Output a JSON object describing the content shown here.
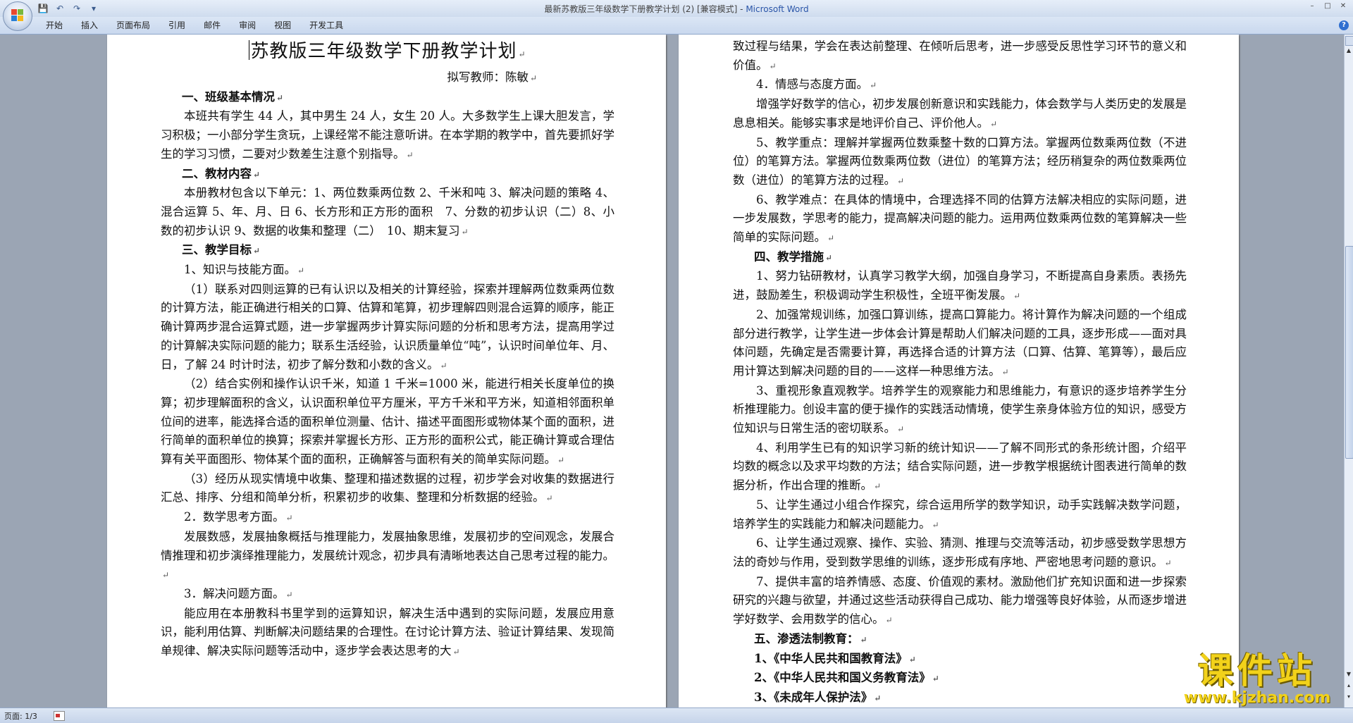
{
  "window": {
    "title": "最新苏教版三年级数学下册教学计划 (2) [兼容模式] - ",
    "app_name": "Microsoft Word"
  },
  "ribbon": {
    "tabs": [
      "开始",
      "插入",
      "页面布局",
      "引用",
      "邮件",
      "审阅",
      "视图",
      "开发工具"
    ]
  },
  "quick_access": [
    "save-icon",
    "undo-icon",
    "redo-icon",
    "customize-icon"
  ],
  "status": {
    "page": "页面: 1/3"
  },
  "watermark": {
    "text": "课件站",
    "url": "www.kjzhan.com"
  },
  "page_left": {
    "title": "苏教版三年级数学下册教学计划",
    "author": "拟写教师：陈敏",
    "paragraphs": [
      {
        "cls": "h",
        "text": "一、班级基本情况"
      },
      {
        "cls": "ind2",
        "text": "本班共有学生 44 人，其中男生 24 人，女生 20 人。大多数学生上课大胆发言，学习积极；一小部分学生贪玩，上课经常不能注意听讲。在本学期的教学中，首先要抓好学生的学习习惯，二要对少数差生注意个别指导。"
      },
      {
        "cls": "h",
        "text": "二、教材内容"
      },
      {
        "cls": "ind2",
        "text": "本册教材包含以下单元：1、两位数乘两位数 2、千米和吨 3、解决问题的策略 4、混合运算 5、年、月、日 6、长方形和正方形的面积　7、分数的初步认识（二）8、小数的初步认识 9、数据的收集和整理（二）　10、期末复习"
      },
      {
        "cls": "h",
        "text": "三、教学目标"
      },
      {
        "cls": "ind2",
        "text": "1、知识与技能方面。"
      },
      {
        "cls": "ind2",
        "text": "（1）联系对四则运算的已有认识以及相关的计算经验，探索并理解两位数乘两位数的计算方法，能正确进行相关的口算、估算和笔算，初步理解四则混合运算的顺序，能正确计算两步混合运算式题，进一步掌握两步计算实际问题的分析和思考方法，提高用学过的计算解决实际问题的能力；联系生活经验，认识质量单位“吨”，认识时间单位年、月、日，了解 24 时计时法，初步了解分数和小数的含义。"
      },
      {
        "cls": "ind2",
        "text": "（2）结合实例和操作认识千米，知道 1 千米=1000 米，能进行相关长度单位的换算；初步理解面积的含义，认识面积单位平方厘米，平方千米和平方米，知道相邻面积单位间的进率，能选择合适的面积单位测量、估计、描述平面图形或物体某个面的面积，进行简单的面积单位的换算；探索并掌握长方形、正方形的面积公式，能正确计算或合理估算有关平面图形、物体某个面的面积，正确解答与面积有关的简单实际问题。"
      },
      {
        "cls": "ind2",
        "text": "（3）经历从现实情境中收集、整理和描述数据的过程，初步学会对收集的数据进行汇总、排序、分组和简单分析，积累初步的收集、整理和分析数据的经验。"
      },
      {
        "cls": "ind2",
        "text": "2．数学思考方面。"
      },
      {
        "cls": "ind2",
        "text": "发展数感，发展抽象概括与推理能力，发展抽象思维，发展初步的空间观念，发展合情推理和初步演绎推理能力，发展统计观念，初步具有清晰地表达自己思考过程的能力。"
      },
      {
        "cls": "ind2",
        "text": "3．解决问题方面。"
      },
      {
        "cls": "ind2",
        "text": "能应用在本册教科书里学到的运算知识，解决生活中遇到的实际问题，发展应用意识，能利用估算、判断解决问题结果的合理性。在讨论计算方法、验证计算结果、发现简单规律、解决实际问题等活动中，逐步学会表达思考的大"
      }
    ]
  },
  "page_right": {
    "paragraphs": [
      {
        "cls": "",
        "text": "致过程与结果，学会在表达前整理、在倾听后思考，进一步感受反思性学习环节的意义和价值。"
      },
      {
        "cls": "ind2",
        "text": "4．情感与态度方面。"
      },
      {
        "cls": "ind2",
        "text": "增强学好数学的信心，初步发展创新意识和实践能力，体会数学与人类历史的发展是息息相关。能够实事求是地评价自己、评价他人。"
      },
      {
        "cls": "ind2",
        "text": "5、教学重点：理解并掌握两位数乘整十数的口算方法。掌握两位数乘两位数（不进位）的笔算方法。掌握两位数乘两位数（进位）的笔算方法；经历稍复杂的两位数乘两位数（进位）的笔算方法的过程。"
      },
      {
        "cls": "ind2",
        "text": "6、教学难点：在具体的情境中，合理选择不同的估算方法解决相应的实际问题，进一步发展数，学思考的能力，提高解决问题的能力。运用两位数乘两位数的笔算解决一些简单的实际问题。"
      },
      {
        "cls": "h",
        "text": "四、教学措施"
      },
      {
        "cls": "ind2",
        "text": "1、努力钻研教材，认真学习教学大纲，加强自身学习，不断提高自身素质。表扬先进，鼓励差生，积极调动学生积极性，全班平衡发展。"
      },
      {
        "cls": "ind2",
        "text": "2、加强常规训练，加强口算训练，提高口算能力。将计算作为解决问题的一个组成部分进行教学，让学生进一步体会计算是帮助人们解决问题的工具，逐步形成——面对具体问题，先确定是否需要计算，再选择合适的计算方法（口算、估算、笔算等），最后应用计算达到解决问题的目的——这样一种思维方法。"
      },
      {
        "cls": "ind2",
        "text": "3、重视形象直观教学。培养学生的观察能力和思维能力，有意识的逐步培养学生分析推理能力。创设丰富的便于操作的实践活动情境，使学生亲身体验方位的知识，感受方位知识与日常生活的密切联系。"
      },
      {
        "cls": "ind2",
        "text": "4、利用学生已有的知识学习新的统计知识——了解不同形式的条形统计图，介绍平均数的概念以及求平均数的方法；结合实际问题，进一步教学根据统计图表进行简单的数据分析，作出合理的推断。"
      },
      {
        "cls": "ind2",
        "text": "5、让学生通过小组合作探究，综合运用所学的数学知识，动手实践解决数学问题，培养学生的实践能力和解决问题能力。"
      },
      {
        "cls": "ind2",
        "text": "6、让学生通过观察、操作、实验、猜测、推理与交流等活动，初步感受数学思想方法的奇妙与作用，受到数学思维的训练，逐步形成有序地、严密地思考问题的意识。"
      },
      {
        "cls": "ind2",
        "text": "7、提供丰富的培养情感、态度、价值观的素材。激励他们扩充知识面和进一步探索研究的兴趣与欲望，并通过这些活动获得自己成功、能力增强等良好体验，从而逐步增进学好数学、会用数学的信心。"
      },
      {
        "cls": "h",
        "text": "五、渗透法制教育："
      },
      {
        "cls": "h",
        "text": "1、《中华人民共和国教育法》"
      },
      {
        "cls": "h",
        "text": "2、《中华人民共和国义务教育法》"
      },
      {
        "cls": "h",
        "text": "3、《未成年人保护法》"
      }
    ]
  }
}
